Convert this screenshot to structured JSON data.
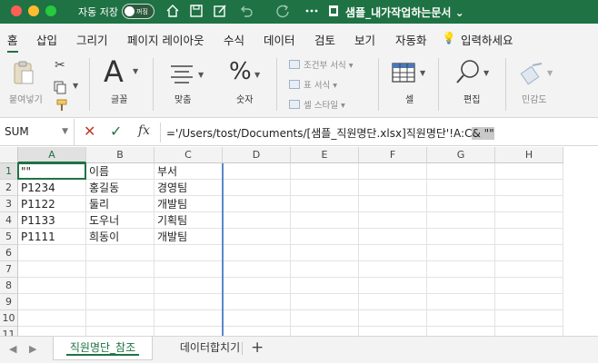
{
  "titlebar": {
    "autosave_label": "자동 저장",
    "autosave_state": "꺼짐",
    "document_title": "샘플_내가작업하는문서 ⌄"
  },
  "ribbon_tabs": [
    "홈",
    "삽입",
    "그리기",
    "페이지 레이아웃",
    "수식",
    "데이터",
    "검토",
    "보기",
    "자동화",
    "입력하세요"
  ],
  "ribbon": {
    "paste_label": "붙여넣기",
    "font_label": "글꼴",
    "align_label": "맞춤",
    "number_label": "숫자",
    "conditional_format": "조건부 서식",
    "table_format": "표 서식",
    "cell_style": "셀 스타일",
    "cells_label": "셀",
    "edit_label": "편집",
    "sensitivity_label": "민감도"
  },
  "formula_bar": {
    "name_box": "SUM",
    "fx": "fx",
    "formula_main": "='/Users/tost/Documents/[샘플_직원명단.xlsx]직원명단'!A:C",
    "formula_tail": "& \"\""
  },
  "grid": {
    "columns": [
      "A",
      "B",
      "C",
      "D",
      "E",
      "F",
      "G",
      "H"
    ],
    "row_numbers": [
      "1",
      "2",
      "3",
      "4",
      "5",
      "6",
      "7",
      "8",
      "9",
      "10",
      "11"
    ],
    "cells": [
      [
        "\"\"",
        "이름",
        "부서"
      ],
      [
        "P1234",
        "홍길동",
        "경영팀"
      ],
      [
        "P1122",
        "둘리",
        "개발팀"
      ],
      [
        "P1133",
        "도우너",
        "기획팀"
      ],
      [
        "P1111",
        "희동이",
        "개발팀"
      ]
    ]
  },
  "sheets": {
    "active": "직원명단_참조",
    "other": "데이터합치기",
    "add": "+"
  },
  "colors": {
    "brand": "#1f7244",
    "selection": "#1f7244",
    "fill_range": "#5b87c7"
  }
}
